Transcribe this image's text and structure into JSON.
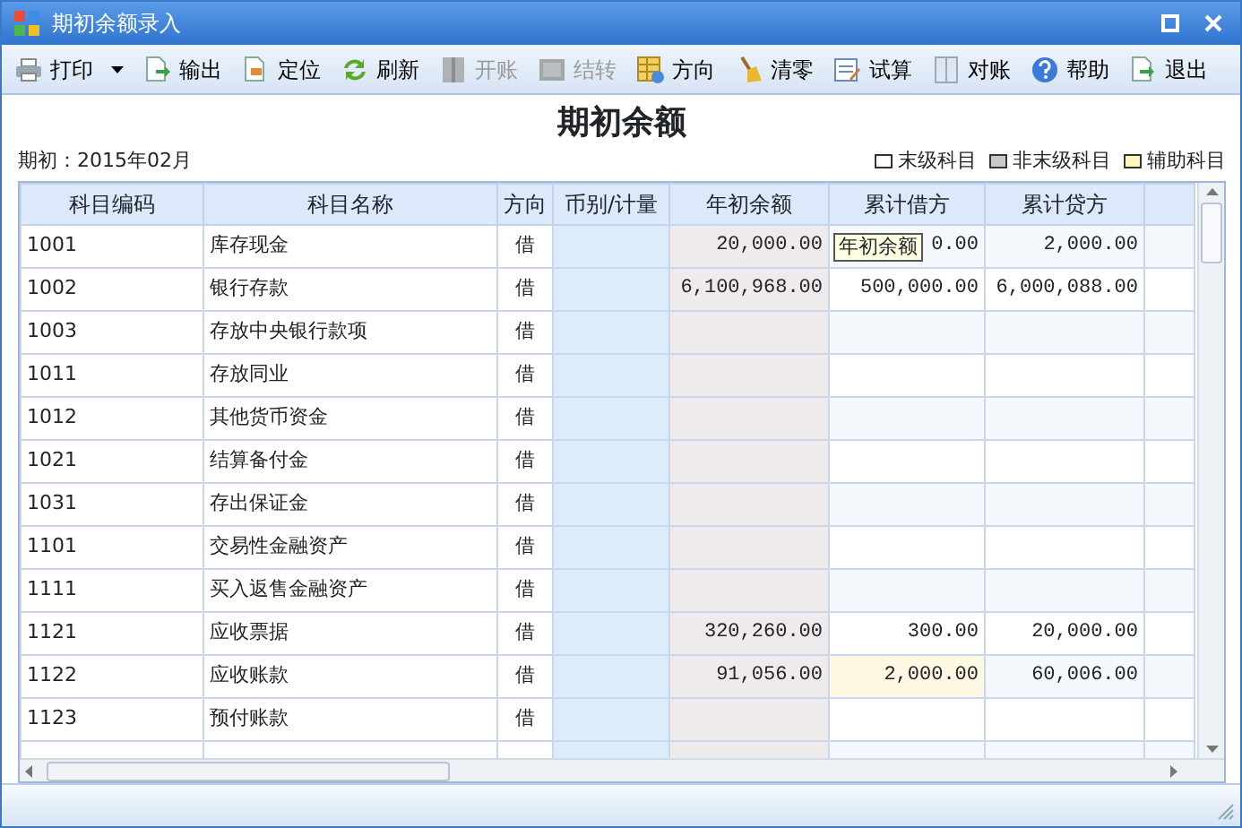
{
  "window": {
    "title": "期初余额录入"
  },
  "toolbar": [
    {
      "label": "打印",
      "disabled": false,
      "dropdown": true
    },
    {
      "label": "输出",
      "disabled": false,
      "dropdown": false
    },
    {
      "label": "定位",
      "disabled": false,
      "dropdown": false
    },
    {
      "label": "刷新",
      "disabled": false,
      "dropdown": false
    },
    {
      "label": "开账",
      "disabled": true,
      "dropdown": false
    },
    {
      "label": "结转",
      "disabled": true,
      "dropdown": false
    },
    {
      "label": "方向",
      "disabled": false,
      "dropdown": false
    },
    {
      "label": "清零",
      "disabled": false,
      "dropdown": false
    },
    {
      "label": "试算",
      "disabled": false,
      "dropdown": false
    },
    {
      "label": "对账",
      "disabled": false,
      "dropdown": false
    },
    {
      "label": "帮助",
      "disabled": false,
      "dropdown": false
    },
    {
      "label": "退出",
      "disabled": false,
      "dropdown": false
    }
  ],
  "heading": "期初余额",
  "period": "期初：2015年02月",
  "legend": [
    {
      "label": "末级科目",
      "color": "#ffffff"
    },
    {
      "label": "非末级科目",
      "color": "#c8c8c8"
    },
    {
      "label": "辅助科目",
      "color": "#fff6c0"
    }
  ],
  "table": {
    "columns": [
      "科目编码",
      "科目名称",
      "方向",
      "币别/计量",
      "年初余额",
      "累计借方",
      "累计贷方"
    ],
    "rows": [
      {
        "code": "1001",
        "name": "库存现金",
        "direction": "借",
        "opening": "20,000.00",
        "debit": "0.00",
        "credit": "2,000.00",
        "debit_focused": false,
        "tooltip": "年初余额"
      },
      {
        "code": "1002",
        "name": "银行存款",
        "direction": "借",
        "opening": "6,100,968.00",
        "debit": "500,000.00",
        "credit": "6,000,088.00",
        "debit_focused": false
      },
      {
        "code": "1003",
        "name": "存放中央银行款项",
        "direction": "借",
        "debit_focused": false
      },
      {
        "code": "1011",
        "name": "存放同业",
        "direction": "借",
        "debit_focused": false
      },
      {
        "code": "1012",
        "name": "其他货币资金",
        "direction": "借",
        "debit_focused": false
      },
      {
        "code": "1021",
        "name": "结算备付金",
        "direction": "借",
        "debit_focused": false
      },
      {
        "code": "1031",
        "name": "存出保证金",
        "direction": "借",
        "debit_focused": false
      },
      {
        "code": "1101",
        "name": "交易性金融资产",
        "direction": "借",
        "debit_focused": false
      },
      {
        "code": "1111",
        "name": "买入返售金融资产",
        "direction": "借",
        "debit_focused": false
      },
      {
        "code": "1121",
        "name": "应收票据",
        "direction": "借",
        "opening": "320,260.00",
        "debit": "300.00",
        "credit": "20,000.00",
        "debit_focused": false
      },
      {
        "code": "1122",
        "name": "应收账款",
        "direction": "借",
        "opening": "91,056.00",
        "debit": "2,000.00",
        "credit": "60,006.00",
        "debit_focused": true
      },
      {
        "code": "1123",
        "name": "预付账款",
        "direction": "借",
        "debit_focused": false
      }
    ]
  }
}
